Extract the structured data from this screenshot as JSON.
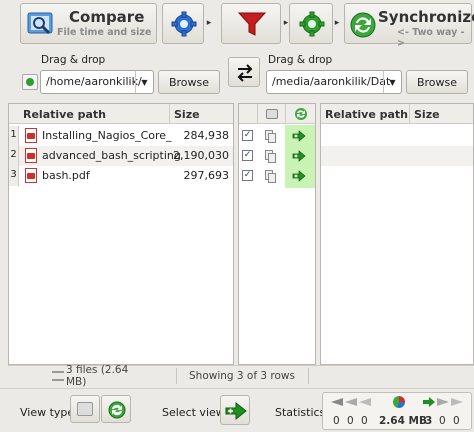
{
  "toolbar": {
    "compare_title": "Compare",
    "compare_subtitle": "File time and size",
    "sync_title": "Synchronize",
    "sync_subtitle": "<- Two way ->"
  },
  "left": {
    "drag_label": "Drag & drop",
    "path": "/home/aaronkilik/",
    "browse_label": "Browse",
    "col_relative_path": "Relative path",
    "col_size": "Size",
    "rows": [
      {
        "num": "1",
        "name": "Installing_Nagios_Core_Fro...",
        "size": "284,938"
      },
      {
        "num": "2",
        "name": "advanced_bash_scripting.pdf",
        "size": "2,190,030"
      },
      {
        "num": "3",
        "name": "bash.pdf",
        "size": "297,693"
      }
    ],
    "footer_files": "3 files (2.64 MB)"
  },
  "right": {
    "drag_label": "Drag & drop",
    "path": "/media/aaronkilik/Dat",
    "browse_label": "Browse",
    "col_relative_path": "Relative path",
    "col_size": "Size"
  },
  "middle": {
    "footer_rows": "Showing 3 of 3 rows"
  },
  "bottom": {
    "view_type_label": "View type:",
    "select_view_label": "Select view:",
    "statistics_label": "Statistics:",
    "stats": {
      "left_create": "0",
      "left_update": "0",
      "left_delete": "0",
      "total_size": "2.64 MB",
      "right_create": "3",
      "right_update": "0",
      "right_delete": "0"
    }
  },
  "colors": {
    "accent_green": "#2e9e2e",
    "action_column_bg": "#c9f2b5",
    "filter_red": "#c41e1e",
    "gear_blue": "#2a6fd1"
  }
}
